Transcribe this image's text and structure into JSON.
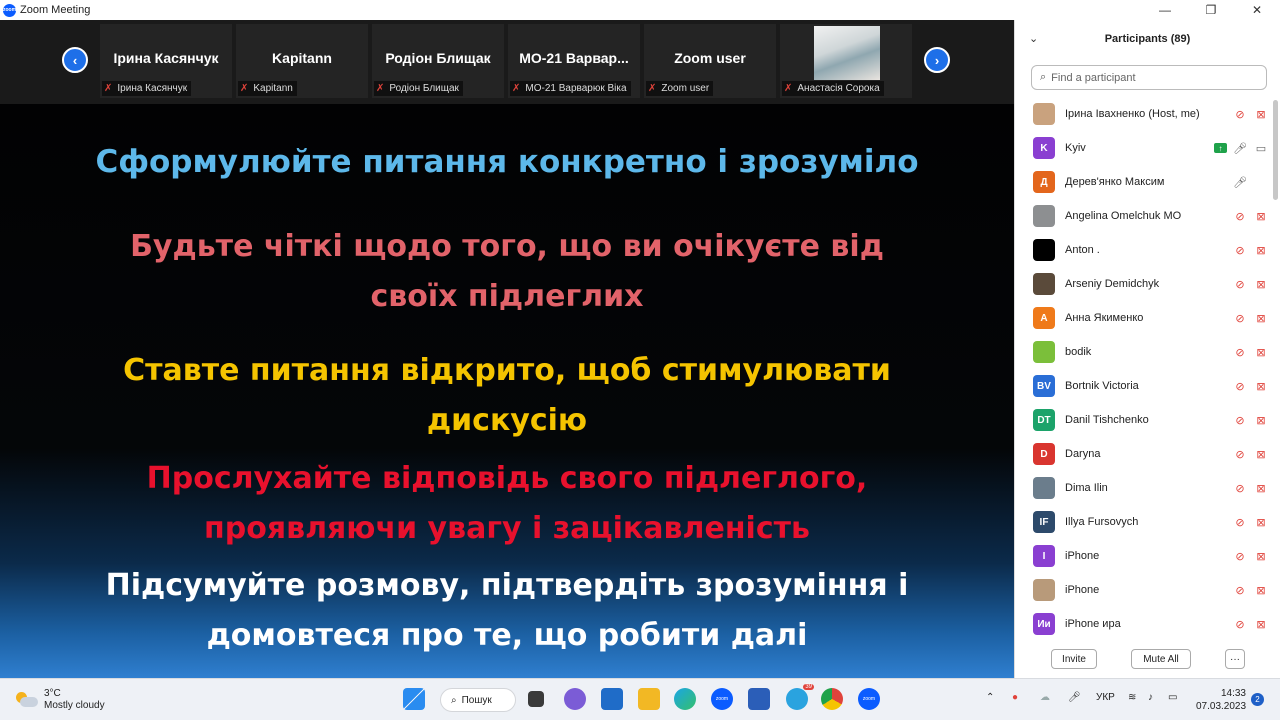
{
  "window": {
    "title": "Zoom Meeting",
    "logo_text": "zoom",
    "minimize": "—",
    "maximize": "❐",
    "close": "✕"
  },
  "strip": {
    "prev": "‹",
    "next": "›",
    "tiles": [
      {
        "name": "Ірина Касянчук",
        "label": "Ірина Касянчук"
      },
      {
        "name": "Kapitann",
        "label": "Kapitann"
      },
      {
        "name": "Родіон Блищак",
        "label": "Родіон Блищак"
      },
      {
        "name": "МО-21  Варвар...",
        "label": "МО-21 Варварюк Віка"
      },
      {
        "name": "Zoom user",
        "label": "Zoom user"
      },
      {
        "name": "",
        "label": "Анастасія Сорока"
      }
    ]
  },
  "slide": {
    "line1": "Сформулюйте питання конкретно і зрозуміло",
    "line2": "Будьте чіткі щодо того, що ви очікуєте від своїх підлеглих",
    "line3": "Ставте питання відкрито, щоб стимулювати дискусію",
    "line4": "Прослухайте відповідь свого підлеглого, проявляючи увагу і зацікавленість",
    "line5": "Підсумуйте розмову, підтвердіть зрозуміння і домовтеся про те, що робити далі"
  },
  "participants": {
    "title": "Participants (89)",
    "search_placeholder": "Find a participant",
    "list": [
      {
        "name": "Ірина Івахненко (Host, me)",
        "initials": "",
        "color": "#c9a27e"
      },
      {
        "name": "Kyiv",
        "initials": "K",
        "color": "#8a3fd1"
      },
      {
        "name": "Дерев'янко Максим",
        "initials": "Д",
        "color": "#e3661c"
      },
      {
        "name": "Angelina Omelchuk MO",
        "initials": "",
        "color": "#8d8f91"
      },
      {
        "name": "Anton .",
        "initials": "",
        "color": "#000000"
      },
      {
        "name": "Arseniy Demidchyk",
        "initials": "",
        "color": "#5a4a3a"
      },
      {
        "name": "Анна Якименко",
        "initials": "А",
        "color": "#ef7a1a"
      },
      {
        "name": "bodik",
        "initials": "",
        "color": "#7bbf3a"
      },
      {
        "name": "Bortnik Victoria",
        "initials": "BV",
        "color": "#2a6ed6"
      },
      {
        "name": "Danil Tishchenko",
        "initials": "DT",
        "color": "#1ca36a"
      },
      {
        "name": "Daryna",
        "initials": "D",
        "color": "#d9352f"
      },
      {
        "name": "Dima Ilin",
        "initials": "",
        "color": "#6b7d8c"
      },
      {
        "name": "Illya Fursovych",
        "initials": "IF",
        "color": "#2d4a6b"
      },
      {
        "name": "iPhone",
        "initials": "I",
        "color": "#8a3fd1"
      },
      {
        "name": "iPhone",
        "initials": "",
        "color": "#b89a7a"
      },
      {
        "name": "iPhone ира",
        "initials": "Ии",
        "color": "#8a3fd1"
      }
    ],
    "invite": "Invite",
    "mute_all": "Mute All",
    "more": "···"
  },
  "taskbar": {
    "temperature": "3°C",
    "weather": "Mostly cloudy",
    "search": "Пошук",
    "lang": "УКР",
    "time": "14:33",
    "date": "07.03.2023",
    "notifications": "2",
    "telegram_badge": "39",
    "zoom_text": "zoom"
  },
  "colors": {
    "accent": "#1e6fe8",
    "muted": "#e0433b"
  }
}
